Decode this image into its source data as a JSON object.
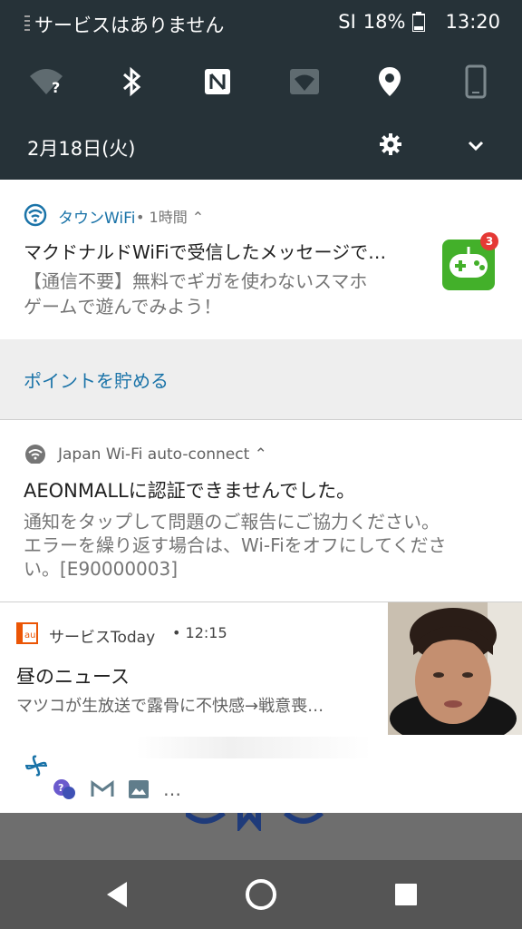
{
  "status_bar": {
    "carrier_text": "サービスはありません",
    "signal": "SI",
    "battery": "18%",
    "time": "13:20"
  },
  "quick_settings": {
    "tiles": [
      "wifi-question-icon",
      "bluetooth-icon",
      "nfc-icon",
      "wifi-tile-icon",
      "location-icon",
      "phone-icon"
    ],
    "date": "2月18日(火)"
  },
  "notifications": [
    {
      "app": "タウンWiFi",
      "meta": "• 1時間",
      "title": "マクドナルドWiFiで受信したメッセージで…",
      "body_line1": "【通信不要】無料でギガを使わないスマホ",
      "body_line2": "ゲームで遊んでみよう！",
      "badge": "3",
      "action": "ポイントを貯める"
    },
    {
      "app": "Japan Wi-Fi auto-connect",
      "title": "AEONMALLに認証できませんでした。",
      "body_line1": "通知をタップして問題のご報告にご協力ください。",
      "body_line2": "エラーを繰り返す場合は、Wi-Fiをオフにしてくださ",
      "body_line3": "い。[E90000003]"
    },
    {
      "app": "サービスToday",
      "time": "• 12:15",
      "title": "昼のニュース",
      "body": "マツコが生放送で露骨に不快感→戦意喪…",
      "app_icon_text": "au"
    },
    {
      "more": "…"
    }
  ],
  "colors": {
    "shade": "#263238",
    "accent": "#1a73a8",
    "gamepad": "#43b02a",
    "badge": "#e53935",
    "au_orange": "#eb5505"
  }
}
